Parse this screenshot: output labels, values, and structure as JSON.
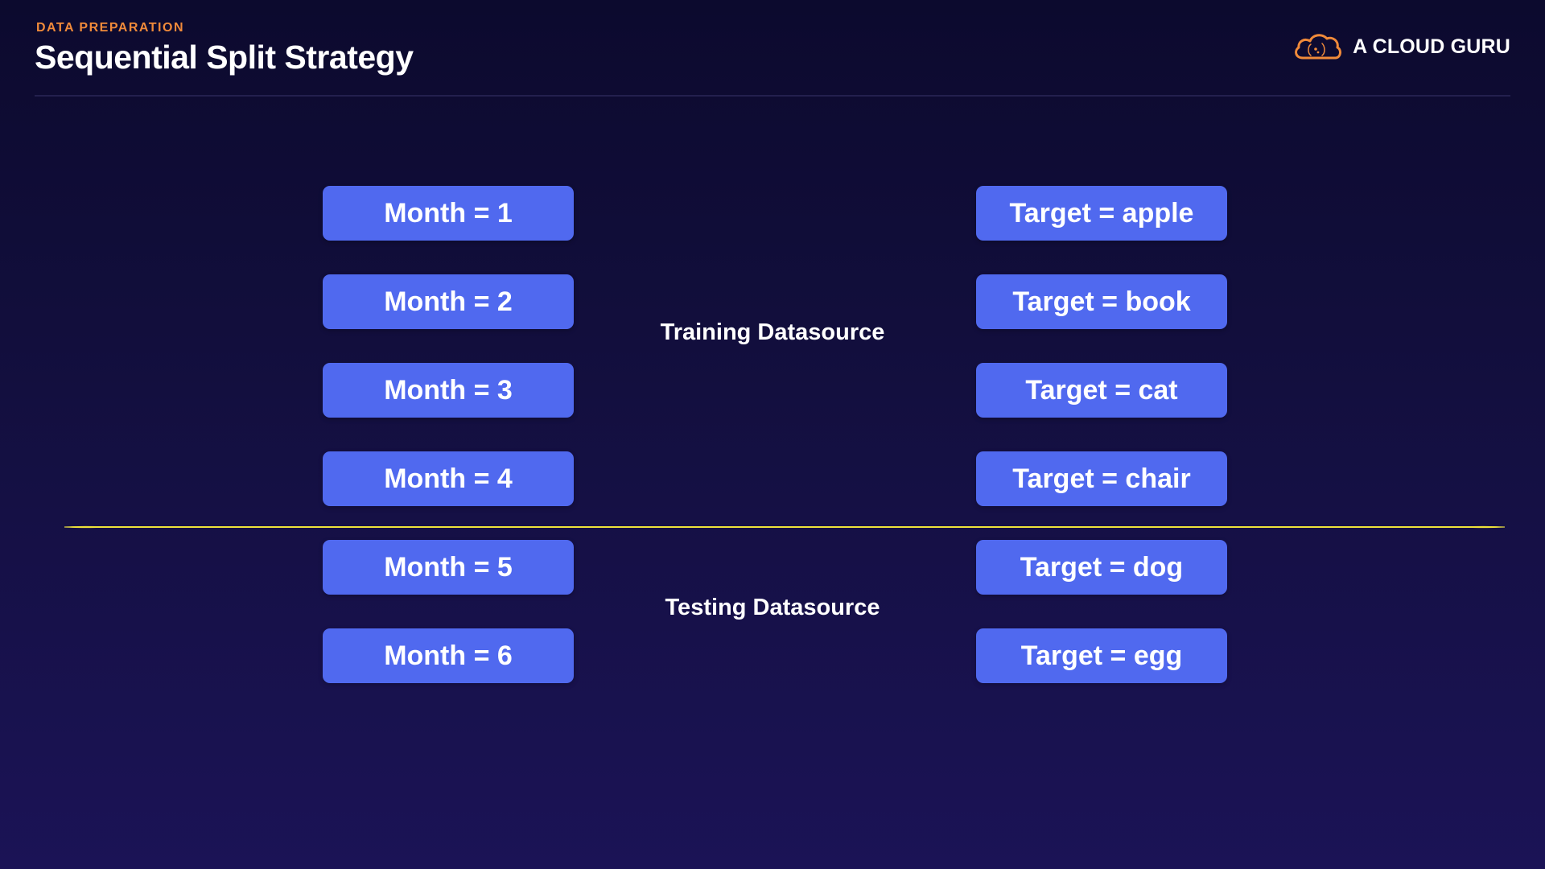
{
  "header": {
    "eyebrow": "DATA PREPARATION",
    "title": "Sequential Split Strategy"
  },
  "brand": {
    "name": "A CLOUD GURU",
    "icon": "cloud-logo-icon",
    "color": "#f08a3a"
  },
  "colors": {
    "pill": "#5069ef",
    "split_line": "#e8dc2a",
    "background_top": "#0c0a2e",
    "background_bottom": "#1b1356"
  },
  "months": [
    "Month = 1",
    "Month = 2",
    "Month = 3",
    "Month = 4",
    "Month = 5",
    "Month = 6"
  ],
  "targets": [
    "Target = apple",
    "Target = book",
    "Target = cat",
    "Target = chair",
    "Target = dog",
    "Target = egg"
  ],
  "labels": {
    "training": "Training Datasource",
    "testing": "Testing Datasource"
  }
}
